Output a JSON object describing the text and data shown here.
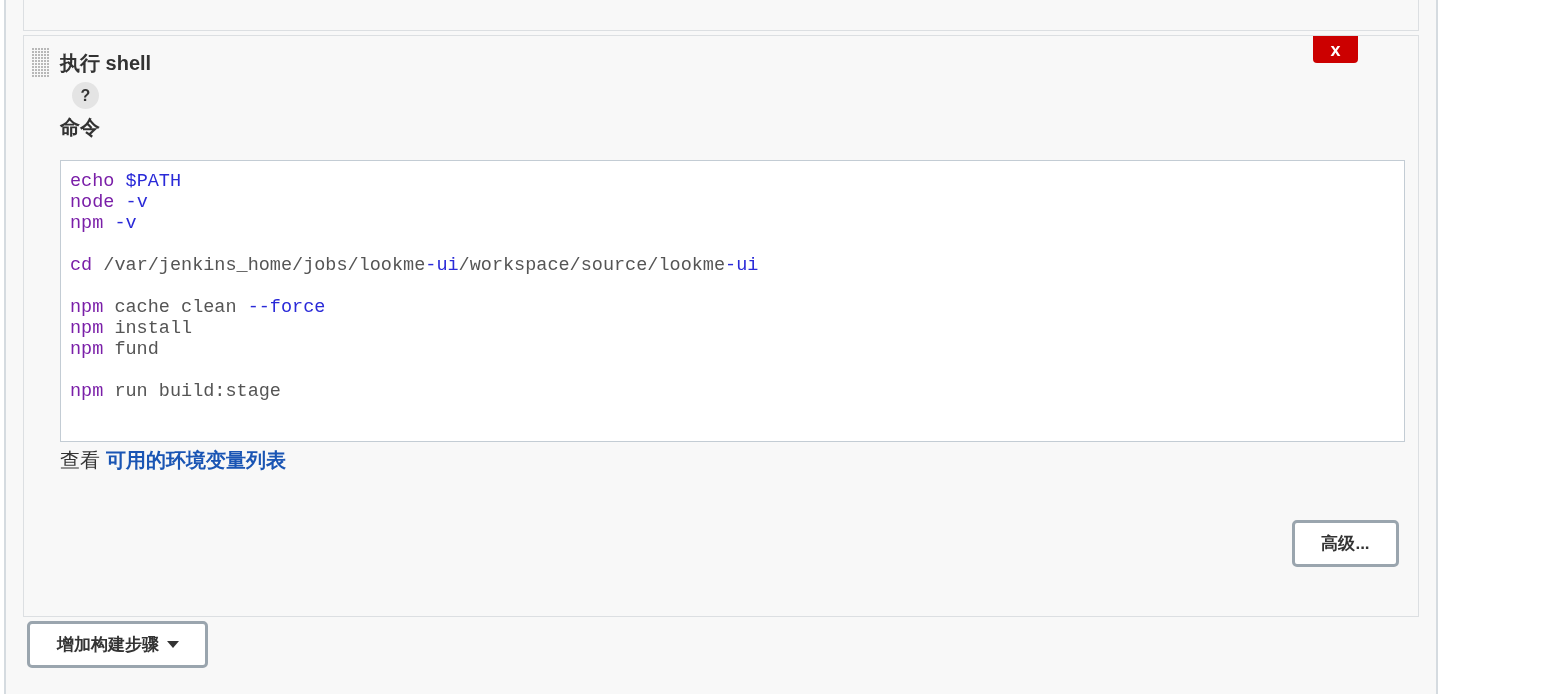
{
  "build_step": {
    "title": "执行 shell",
    "delete_button": "x",
    "help": "?",
    "field_label": "命令",
    "code_blocks": [
      [
        [
          {
            "text": "echo",
            "kind": "command"
          },
          {
            "text": " $PATH",
            "kind": "flag"
          }
        ],
        [
          {
            "text": "node",
            "kind": "command"
          },
          {
            "text": " -v",
            "kind": "flag"
          }
        ],
        [
          {
            "text": "npm",
            "kind": "command"
          },
          {
            "text": " -v",
            "kind": "flag"
          }
        ]
      ],
      [
        [
          {
            "text": "cd",
            "kind": "command"
          },
          {
            "text": " /var/jenkins_home/jobs/lookme"
          },
          {
            "text": "-ui",
            "kind": "flag"
          },
          {
            "text": "/workspace/source/lookme"
          },
          {
            "text": "-ui",
            "kind": "flag"
          }
        ]
      ],
      [
        [
          {
            "text": "npm",
            "kind": "command"
          },
          {
            "text": " cache clean "
          },
          {
            "text": "--force",
            "kind": "flag"
          }
        ],
        [
          {
            "text": "npm",
            "kind": "command"
          },
          {
            "text": " install"
          }
        ],
        [
          {
            "text": "npm",
            "kind": "command"
          },
          {
            "text": " fund"
          }
        ]
      ],
      [
        [
          {
            "text": "npm",
            "kind": "command"
          },
          {
            "text": " run build:stage"
          }
        ]
      ]
    ],
    "hint": {
      "text": "查看",
      "link": "可用的环境变量列表"
    },
    "advanced_button": "高级..."
  },
  "add_step_button": "增加构建步骤"
}
